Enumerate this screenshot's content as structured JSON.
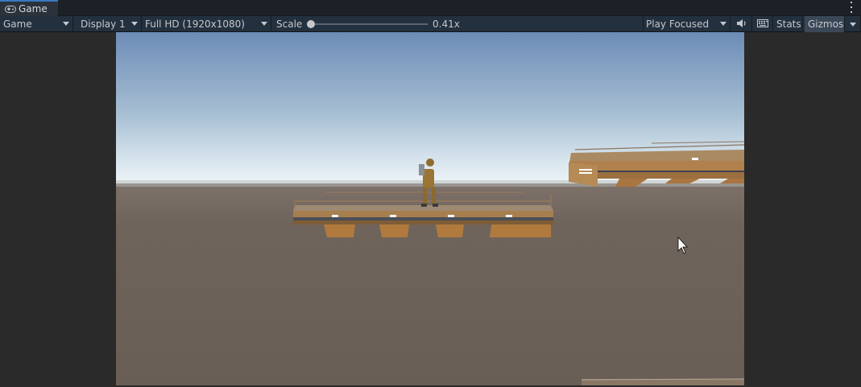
{
  "tab": {
    "label": "Game",
    "icon": "gamepad-icon"
  },
  "toolbar": {
    "view_select": "Game",
    "display_select": "Display 1",
    "resolution_select": "Full HD (1920x1080)",
    "scale_label": "Scale",
    "scale_value": "0.41x",
    "scale_level": 0.0,
    "play_mode_select": "Play Focused",
    "stats_label": "Stats",
    "gizmos_label": "Gizmos",
    "icons": [
      "audio-mute-icon",
      "keyboard-icon",
      "chevron-down-icon",
      "more-options-icon"
    ]
  },
  "colors": {
    "accent": "#3a79bb",
    "toolbar_bg": "#23303e",
    "sky_top": "#6f8fb8",
    "horizon": "#dfe9ef",
    "ground": "#6c6258"
  }
}
